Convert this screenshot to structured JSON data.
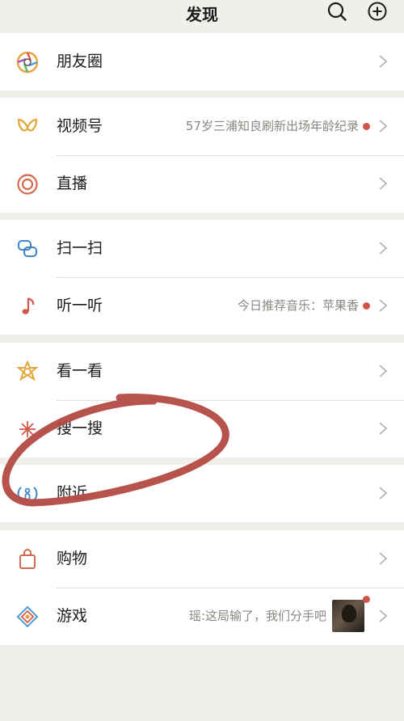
{
  "header": {
    "title": "发现"
  },
  "groups": [
    {
      "items": [
        {
          "label": "朋友圈",
          "icon": "moments-icon"
        }
      ]
    },
    {
      "items": [
        {
          "label": "视频号",
          "extra": "57岁三浦知良刷新出场年龄纪录",
          "icon": "channels-icon"
        },
        {
          "label": "直播",
          "icon": "live-icon"
        }
      ]
    },
    {
      "items": [
        {
          "label": "扫一扫",
          "icon": "scan-icon"
        },
        {
          "label": "听一听",
          "extra": "今日推荐音乐：苹果香",
          "icon": "music-note-icon"
        }
      ]
    },
    {
      "items": [
        {
          "label": "看一看",
          "icon": "top-stories-icon"
        },
        {
          "label": "搜一搜",
          "icon": "search-sparkle-icon"
        }
      ]
    },
    {
      "items": [
        {
          "label": "附近",
          "icon": "nearby-icon"
        }
      ]
    },
    {
      "items": [
        {
          "label": "购物",
          "icon": "shopping-bag-icon"
        },
        {
          "label": "游戏",
          "extra": "瑶:这局输了，我们分手吧",
          "icon": "game-icon"
        }
      ]
    }
  ],
  "colors": {
    "background": "#f1efea",
    "badge": "#d0564c",
    "scribble": "#b34a43"
  }
}
